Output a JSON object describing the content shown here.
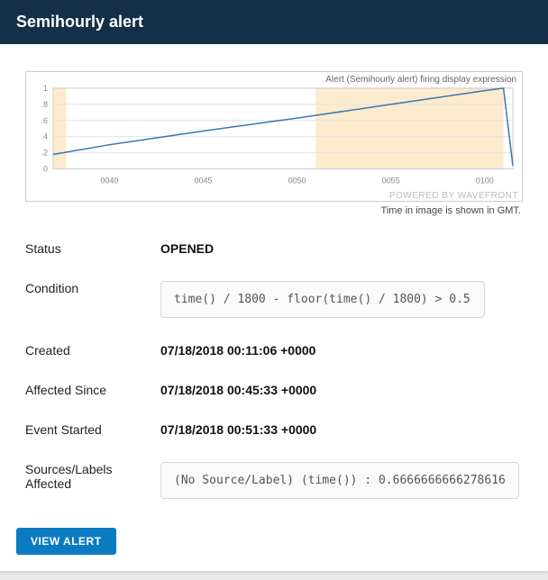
{
  "header": {
    "title": "Semihourly alert"
  },
  "chart_data": {
    "type": "line",
    "title": "Alert (Semihourly alert) firing display expression",
    "x": [
      "0037",
      "0040",
      "0045",
      "0050",
      "0055",
      "0100",
      "0101",
      "0101.5"
    ],
    "values": [
      0.18,
      0.3,
      0.47,
      0.63,
      0.8,
      0.97,
      1.0,
      0.04
    ],
    "ylabel": "",
    "xlabel": "",
    "ylim": [
      0,
      1
    ],
    "yticks": [
      0,
      0.2,
      0.4,
      0.6,
      0.8,
      1
    ],
    "xticks": [
      "0040",
      "0045",
      "0050",
      "0055",
      "0100"
    ],
    "highlight_range_x": [
      "0051",
      "0101"
    ],
    "left_band_x": [
      "0037",
      "0037.7"
    ]
  },
  "attribution": "POWERED BY WAVEFRONT",
  "tz_note": "Time in image is shown in GMT.",
  "fields": {
    "status_label": "Status",
    "status_value": "OPENED",
    "condition_label": "Condition",
    "condition_value": "time() / 1800 - floor(time() / 1800) > 0.5",
    "created_label": "Created",
    "created_value": "07/18/2018 00:11:06 +0000",
    "affected_label": "Affected Since",
    "affected_value": "07/18/2018 00:45:33 +0000",
    "event_label": "Event Started",
    "event_value": "07/18/2018 00:51:33 +0000",
    "sources_label": "Sources/Labels Affected",
    "sources_value": "(No Source/Label) (time()) : 0.6666666666278616"
  },
  "actions": {
    "view_alert": "VIEW ALERT"
  }
}
